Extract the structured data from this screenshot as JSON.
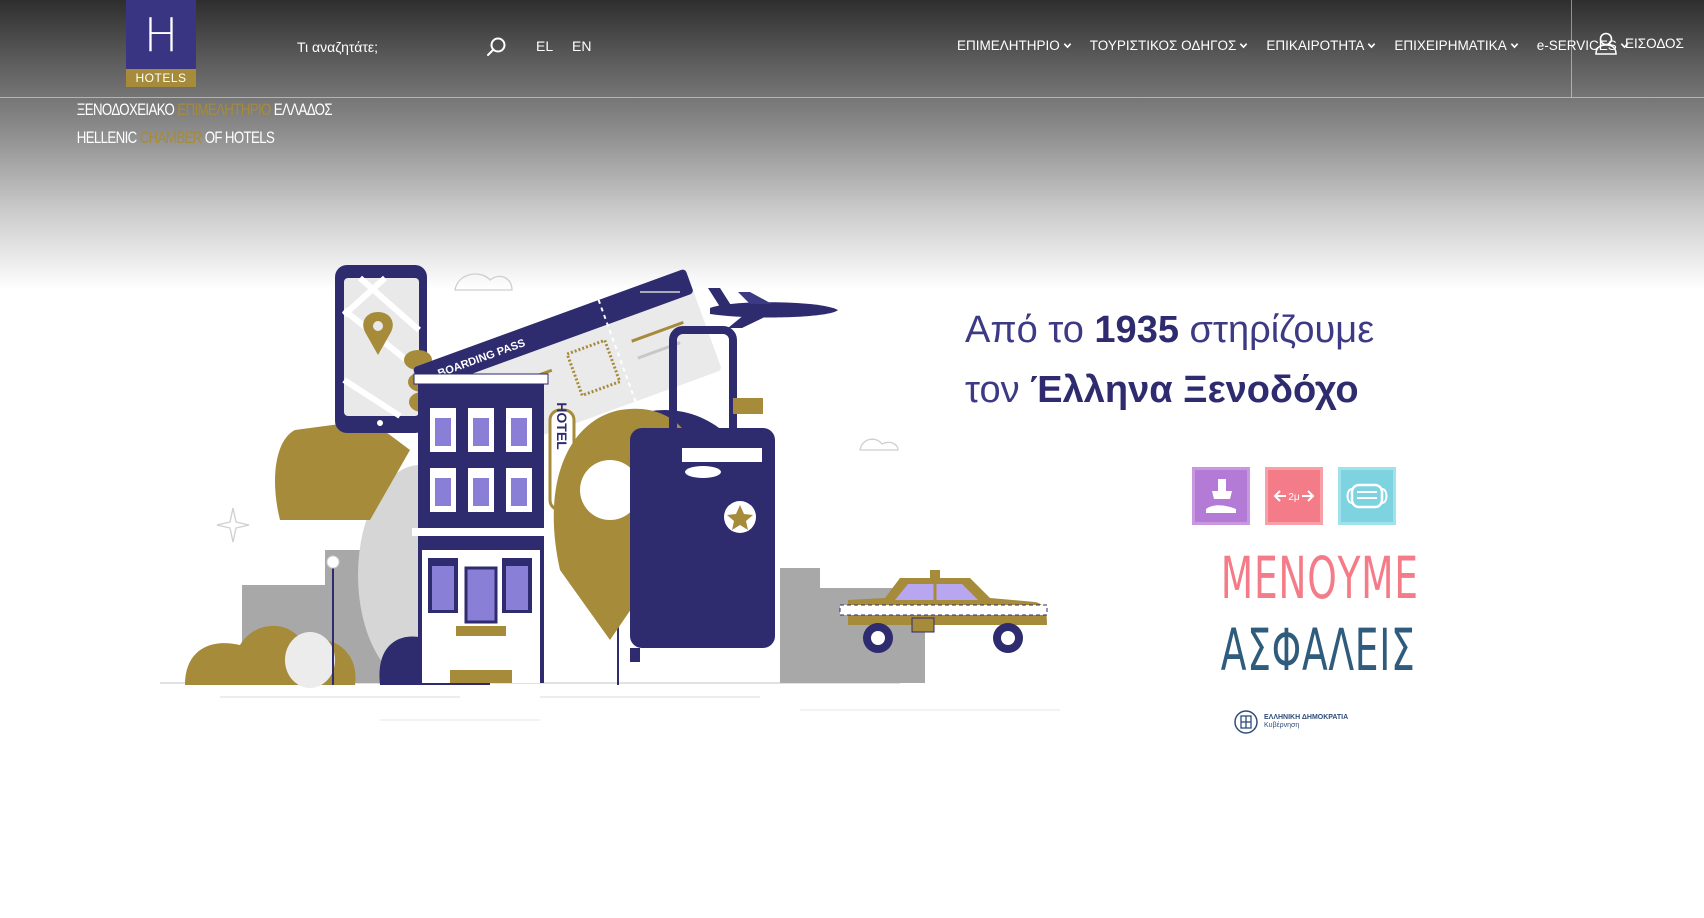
{
  "logo": {
    "letter": "H",
    "word": "HOTELS",
    "line1_a": "ΞΕΝΟΔΟΧΕΙΑΚΟ ",
    "line1_b": "ΕΠΙΜΕΛΗΤΗΡΙΟ",
    "line1_c": " ΕΛΛΑΔΟΣ",
    "line2_a": "HELLENIC ",
    "line2_b": "CHAMBER",
    "line2_c": " OF HOTELS"
  },
  "search": {
    "placeholder": "Τι αναζητάτε;"
  },
  "languages": [
    "EL",
    "EN"
  ],
  "nav": [
    {
      "label": "ΕΠΙΜΕΛΗΤΗΡΙΟ"
    },
    {
      "label": "ΤΟΥΡΙΣΤΙΚΟΣ ΟΔΗΓΟΣ"
    },
    {
      "label": "ΕΠΙΚΑΙΡΟΤΗΤΑ"
    },
    {
      "label": "ΕΠΙΧΕΙΡΗΜΑΤΙΚΑ"
    },
    {
      "label": "e-SERVICES"
    }
  ],
  "login_label": "ΕΙΣΟΔΟΣ",
  "hero": {
    "line1_a": "Από το ",
    "line1_b": "1935",
    "line1_c": " στηρίζουμε",
    "line2_a": "τον ",
    "line2_b": "Έλληνα Ξενοδόχο"
  },
  "illustration": {
    "boarding_pass": "BOARDING PASS",
    "hotel_sign": "HOTEL"
  },
  "safety_badge": {
    "distance_label": "2μ",
    "title_1": "ΜΕΝΟΥΜΕ",
    "title_2": "ΑΣΦΑΛΕΙΣ",
    "gov_1": "ΕΛΛΗΝΙΚΗ ΔΗΜΟΚΡΑΤΙΑ",
    "gov_2": "Κυβέρνηση"
  },
  "colors": {
    "brand_purple": "#3a3582",
    "brand_gold": "#a58b3a",
    "headline": "#2e2b6f",
    "safety_pink": "#f47c88",
    "safety_blue": "#2f5b7c"
  }
}
